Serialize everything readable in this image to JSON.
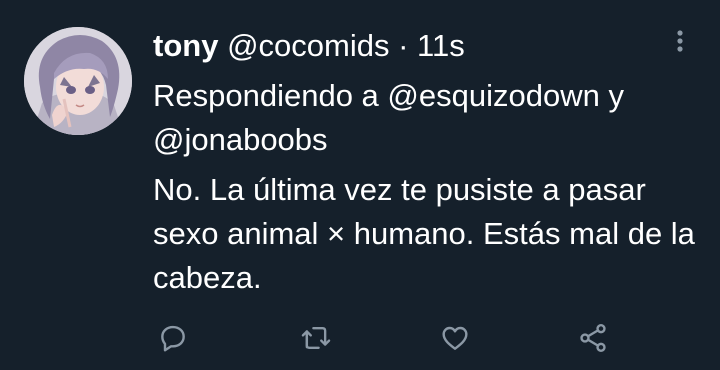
{
  "tweet": {
    "display_name": "tony",
    "handle": "@cocomids",
    "separator": "·",
    "time": "11s",
    "reply_prefix": "Respondiendo a",
    "reply_user1": "@esquizodown",
    "reply_joiner": "y",
    "reply_user2": "@jonaboobs",
    "text": "No. La última vez te pusiste a pasar sexo animal × humano. Estás mal de la cabeza."
  },
  "icons": {
    "more": "more-vertical-icon",
    "reply": "reply-icon",
    "retweet": "retweet-icon",
    "like": "heart-icon",
    "share": "share-icon"
  },
  "colors": {
    "background": "#15202b",
    "text": "#ffffff",
    "icon": "#8b98a5"
  }
}
